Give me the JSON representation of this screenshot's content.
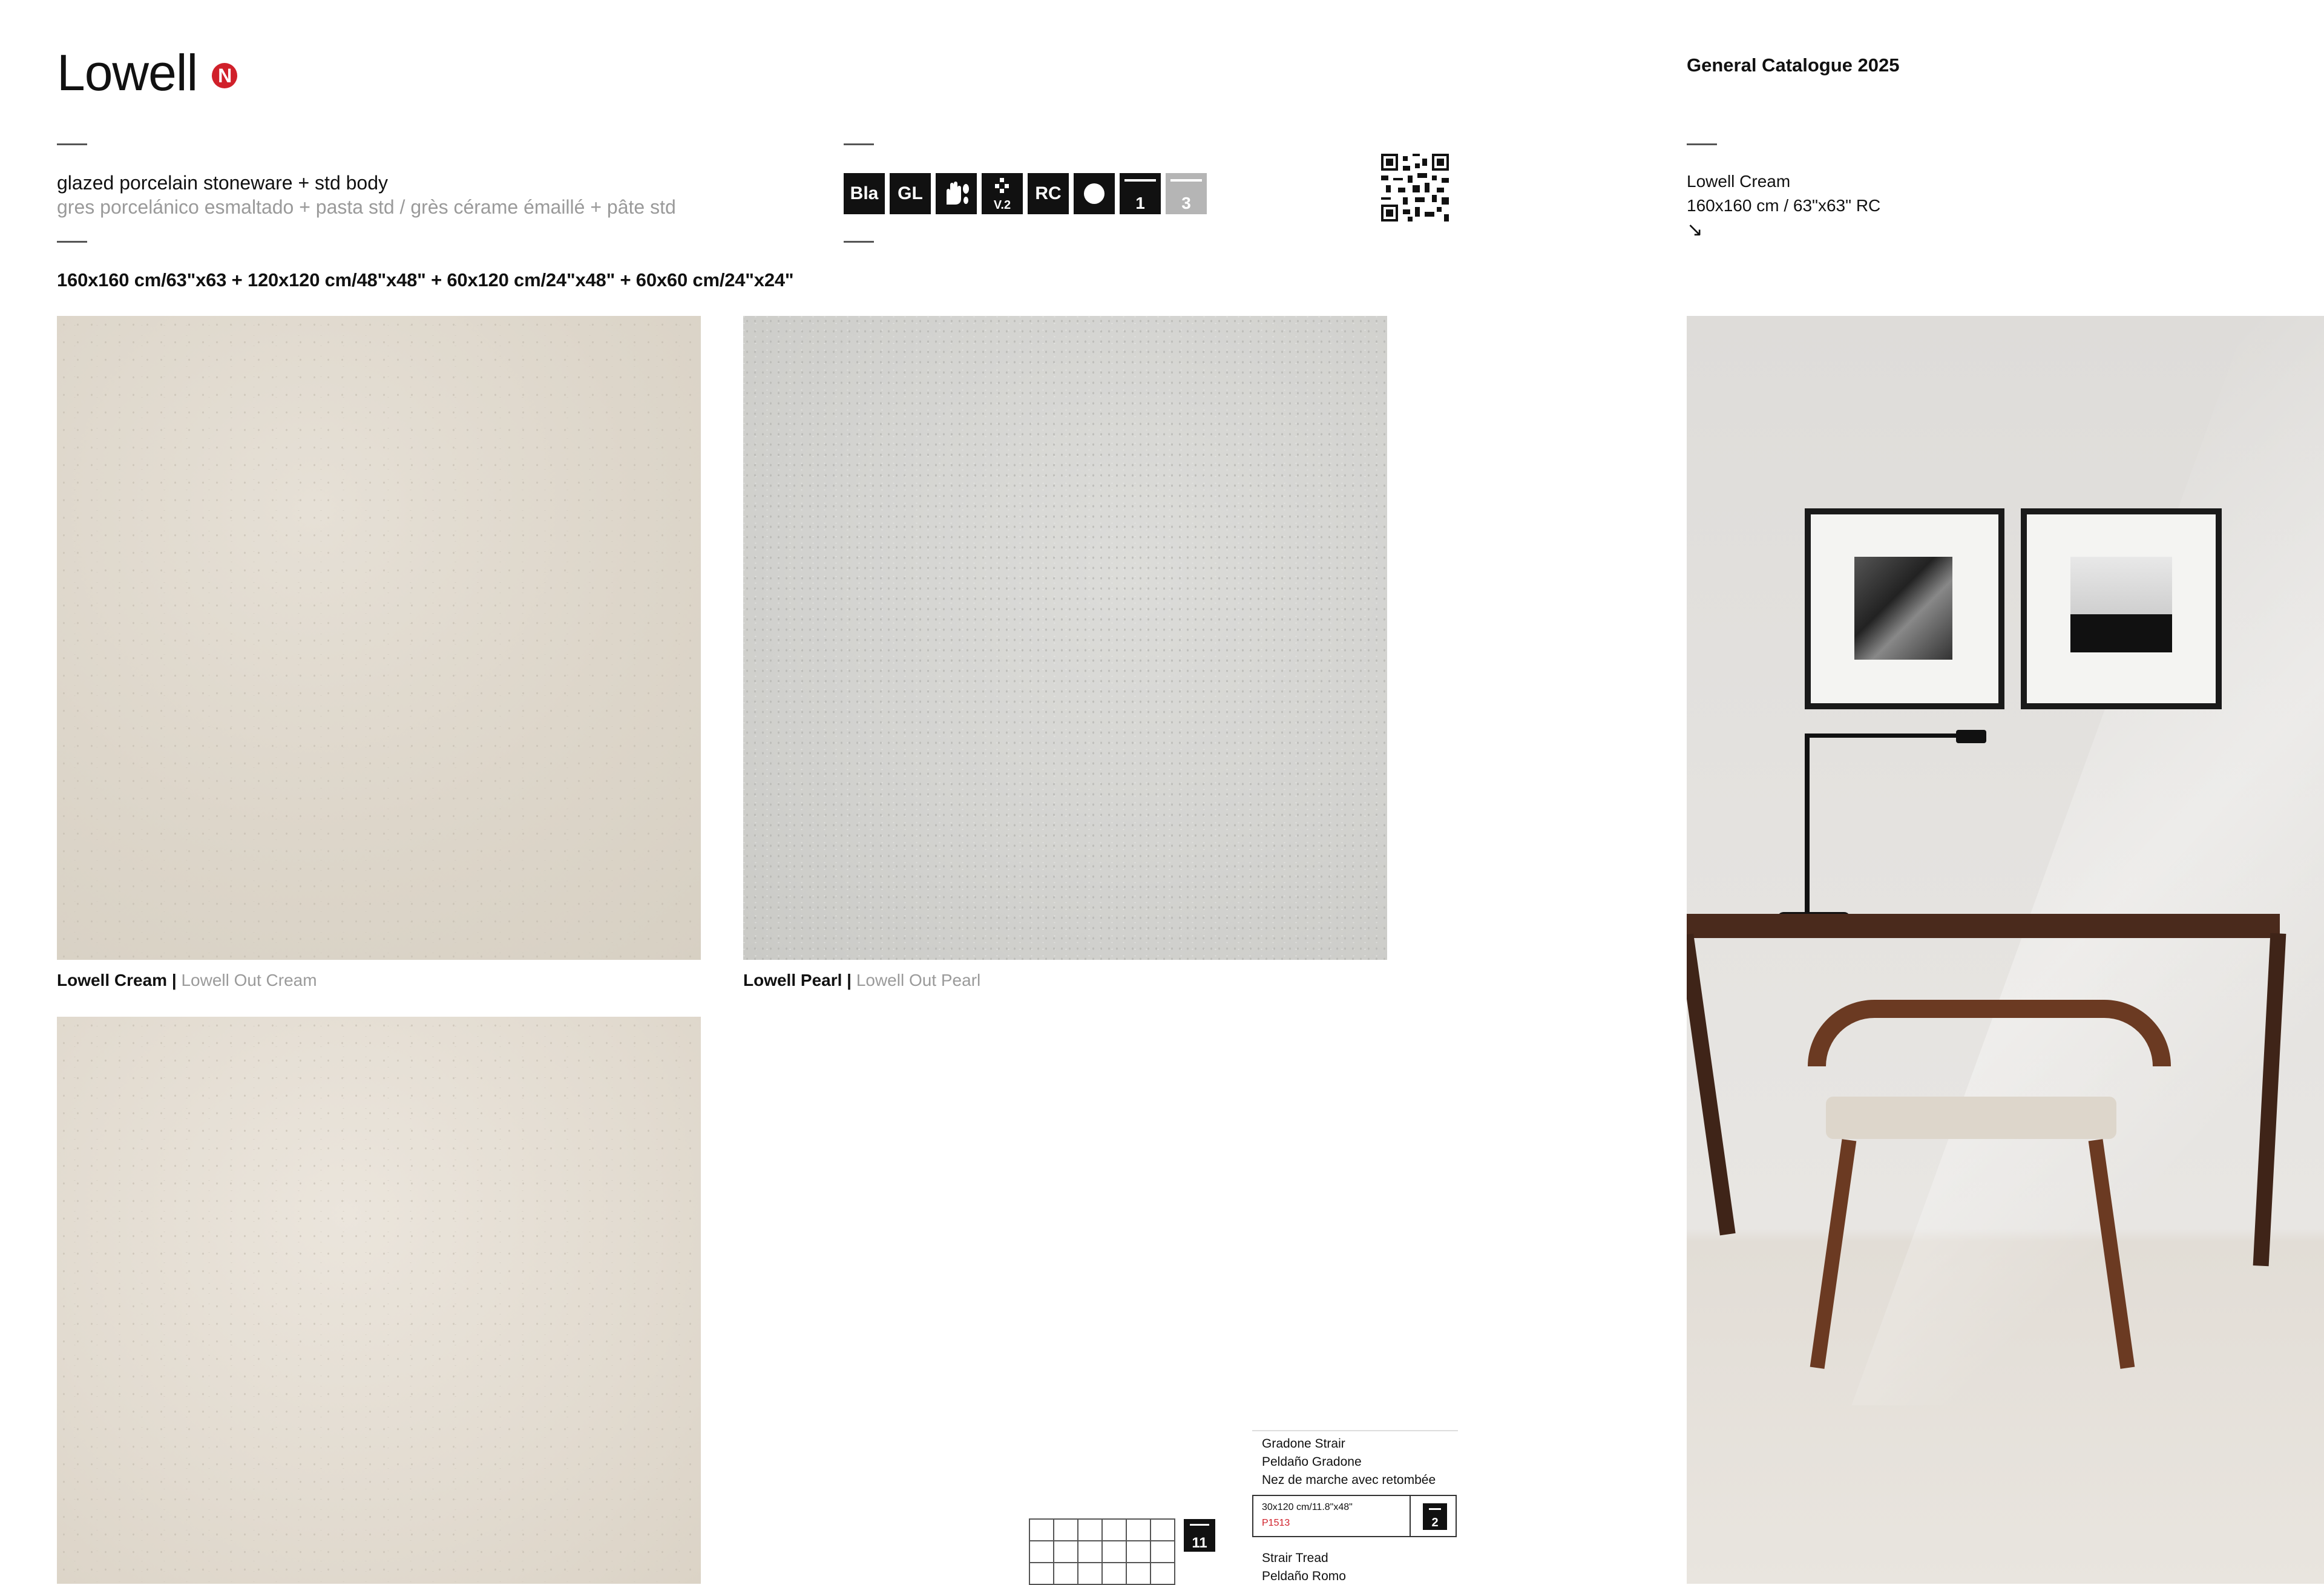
{
  "header": {
    "title": "Lowell",
    "brand_badge": "N",
    "catalogue": "General Catalogue 2025"
  },
  "material": {
    "line1": "glazed porcelain stoneware + std body",
    "line2": "gres porcelánico esmaltado + pasta std / grès cérame émaillé + pâte std"
  },
  "sizes": "160x160 cm/63\"x63 + 120x120 cm/48\"x48\" + 60x120 cm/24\"x48\" + 60x60 cm/24\"x24\"",
  "tech_icons": {
    "bla": "Bla",
    "gl": "GL",
    "v2": "V.2",
    "rc": "RC",
    "pei1": "1",
    "pei3": "3"
  },
  "side_caption": {
    "name": "Lowell Cream",
    "size": "160x160 cm / 63\"x63\" RC",
    "arrow": "↘"
  },
  "tiles": [
    {
      "name": "Lowell Cream",
      "sep": " | ",
      "alt": "Lowell Out Cream"
    },
    {
      "name": "Lowell Pearl",
      "sep": " | ",
      "alt": "Lowell Out Pearl"
    }
  ],
  "trim": {
    "piece1_lines": [
      "Gradone Strair",
      "Peldaño Gradone",
      "Nez de marche avec retombée"
    ],
    "piece1_size": "30x120 cm/11.8\"x48\"",
    "piece1_code": "P1513",
    "piece1_badge": "2",
    "grid_badge": "11",
    "piece2_lines": [
      "Strair Tread",
      "Peldaño Romo"
    ]
  },
  "colors": {
    "brand_red": "#d0202a",
    "cream_tile": "#ddd6ca",
    "pearl_tile": "#d3d3d0"
  }
}
